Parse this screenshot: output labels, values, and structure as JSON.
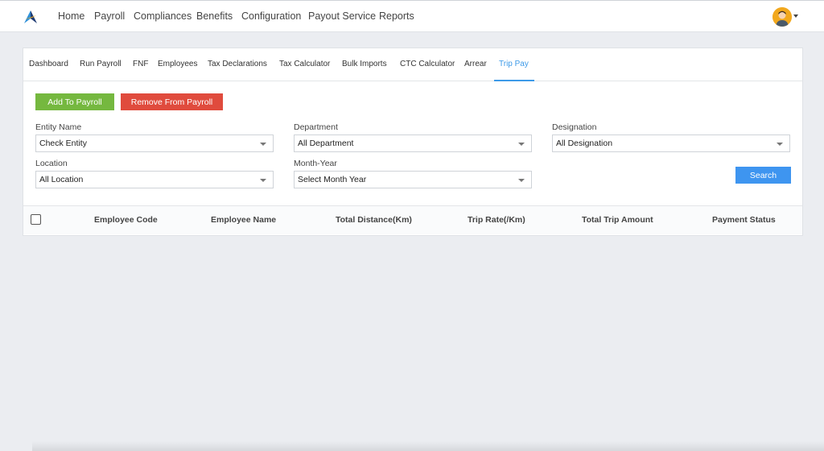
{
  "topnav": {
    "items": [
      "Home",
      "Payroll",
      "Compliances",
      "Benefits",
      "Configuration",
      "Payout Service",
      "Reports"
    ]
  },
  "tabs": {
    "items": [
      "Dashboard",
      "Run Payroll",
      "FNF",
      "Employees",
      "Tax Declarations",
      "Tax Calculator",
      "Bulk Imports",
      "CTC Calculator",
      "Arrear",
      "Trip Pay"
    ],
    "active": "Trip Pay"
  },
  "actions": {
    "add_label": "Add To Payroll",
    "remove_label": "Remove From Payroll",
    "search_label": "Search"
  },
  "filters": {
    "entity": {
      "label": "Entity Name",
      "value": "Check Entity"
    },
    "department": {
      "label": "Department",
      "value": "All Department"
    },
    "designation": {
      "label": "Designation",
      "value": "All Designation"
    },
    "location": {
      "label": "Location",
      "value": "All Location"
    },
    "month_year": {
      "label": "Month-Year",
      "value": "Select Month Year"
    }
  },
  "table": {
    "headers": [
      "Employee Code",
      "Employee Name",
      "Total Distance(Km)",
      "Trip Rate(/Km)",
      "Total Trip Amount",
      "Payment Status"
    ]
  },
  "colors": {
    "accent": "#3d9ae8",
    "add_button": "#75b83f",
    "remove_button": "#e04b3d",
    "search_button": "#3e95f0",
    "avatar": "#f2a81d"
  },
  "icons": {
    "logo": "brand-logo-icon",
    "avatar": "user-avatar-icon",
    "dropdown": "chevron-down-icon",
    "checkbox": "checkbox-icon"
  }
}
